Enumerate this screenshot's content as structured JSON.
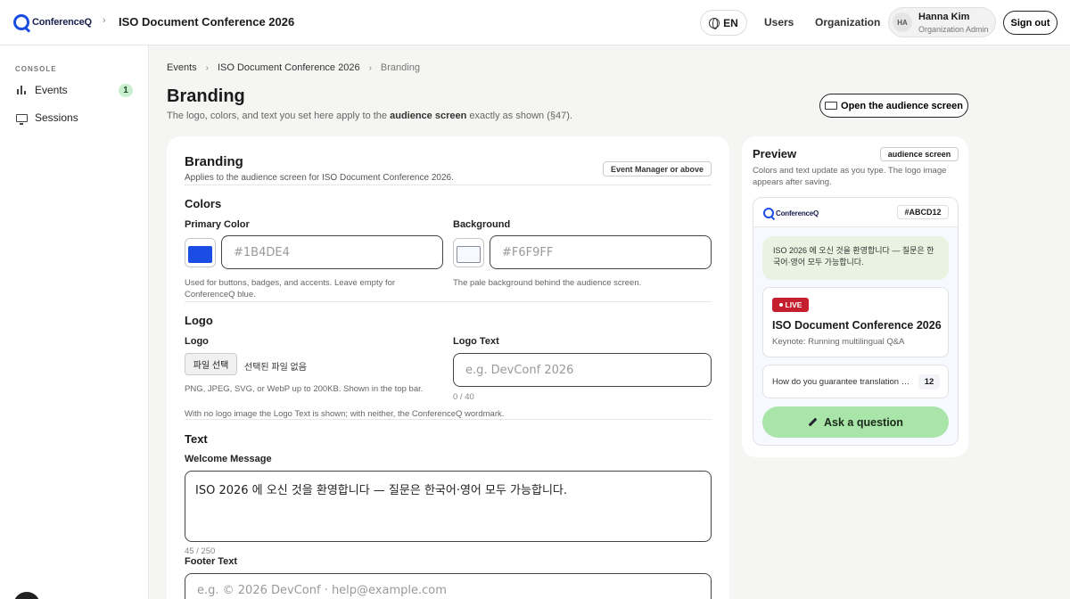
{
  "app": {
    "logo_text": "ConferenceQ"
  },
  "header": {
    "event_title": "ISO Document Conference 2026",
    "lang_label": "EN",
    "nav": {
      "users": "Users",
      "organization": "Organization"
    },
    "user": {
      "initials": "HA",
      "name": "Hanna Kim",
      "role": "Organization Admin"
    },
    "signout_label": "Sign out"
  },
  "sidebar": {
    "heading": "CONSOLE",
    "items": [
      {
        "label": "Events",
        "icon": "bars-icon",
        "badge": "1"
      },
      {
        "label": "Sessions",
        "icon": "monitor-icon"
      }
    ]
  },
  "breadcrumb": [
    "Events",
    "ISO Document Conference 2026",
    "Branding"
  ],
  "page": {
    "title": "Branding",
    "subtitle_pre": "The logo, colors, and text you set here apply to the",
    "subtitle_bold": "audience screen",
    "subtitle_post": "exactly as shown (§47).",
    "open_button": "Open the audience screen"
  },
  "form": {
    "title": "Branding",
    "subtitle": "Applies to the audience screen for ISO Document Conference 2026.",
    "role_tag": "Event Manager or above",
    "colors": {
      "section": "Colors",
      "primary": {
        "label": "Primary Color",
        "placeholder": "#1B4DE4",
        "swatch": "#1B4DE4",
        "help": "Used for buttons, badges, and accents. Leave empty for ConferenceQ blue."
      },
      "background": {
        "label": "Background",
        "placeholder": "#F6F9FF",
        "swatch": "#F6F9FF",
        "help": "The pale background behind the audience screen."
      }
    },
    "logo": {
      "section": "Logo",
      "file_label": "Logo",
      "file_button": "파일 선택",
      "file_none": "선택된 파일 없음",
      "file_help": "PNG, JPEG, SVG, or WebP up to 200KB. Shown in the top bar.",
      "text_label": "Logo Text",
      "text_placeholder": "e.g. DevConf 2026",
      "text_counter": "0 / 40",
      "note": "With no logo image the Logo Text is shown; with neither, the ConferenceQ wordmark."
    },
    "text": {
      "section": "Text",
      "welcome_label": "Welcome Message",
      "welcome_value": "ISO 2026 에 오신 것을 환영합니다 — 질문은 한국어·영어 모두 가능합니다.",
      "welcome_counter": "45 / 250",
      "footer_label": "Footer Text",
      "footer_placeholder": "e.g. © 2026 DevConf · help@example.com"
    }
  },
  "preview": {
    "title": "Preview",
    "tag": "audience screen",
    "subtitle": "Colors and text update as you type. The logo image appears after saving.",
    "hex_badge": "#ABCD12",
    "welcome": "ISO 2026 에 오신 것을 환영합니다 — 질문은 한국어·영어 모두 가능합니다.",
    "live_label": "LIVE",
    "event_name": "ISO Document Conference 2026",
    "keynote": "Keynote: Running multilingual Q&A",
    "question": "How do you guarantee translation quality?",
    "question_count": "12",
    "ask_label": "Ask a question"
  }
}
